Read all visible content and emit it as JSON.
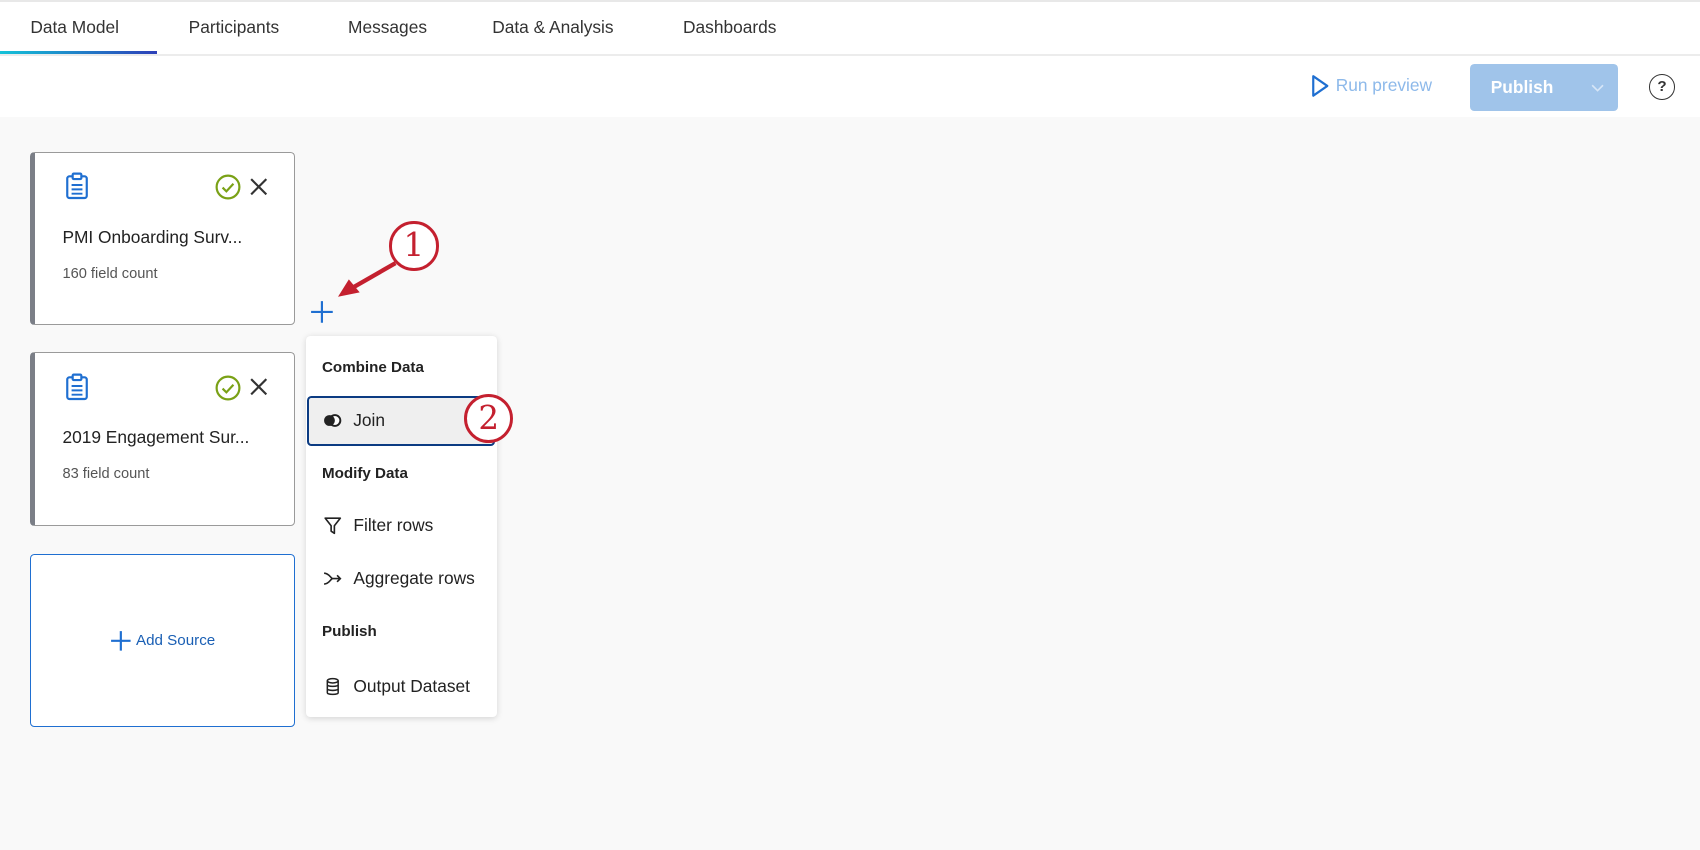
{
  "tabs": [
    {
      "label": "Data Model",
      "active": true
    },
    {
      "label": "Participants"
    },
    {
      "label": "Messages"
    },
    {
      "label": "Data & Analysis"
    },
    {
      "label": "Dashboards"
    }
  ],
  "toolbar": {
    "run_preview": "Run preview",
    "publish": "Publish",
    "help": "?"
  },
  "sources": [
    {
      "title": "PMI Onboarding Surv...",
      "fields": "160 field count"
    },
    {
      "title": "2019 Engagement Sur...",
      "fields": "83 field count"
    }
  ],
  "add_source": "Add Source",
  "menu": {
    "combine": "Combine Data",
    "join": "Join",
    "modify": "Modify Data",
    "filter": "Filter rows",
    "aggregate": "Aggregate rows",
    "publish": "Publish",
    "output": "Output Dataset"
  },
  "annotations": [
    "1",
    "2"
  ],
  "colors": {
    "accent": "#1f6fd1",
    "annotation": "#c4202f",
    "success": "#7aa116"
  }
}
